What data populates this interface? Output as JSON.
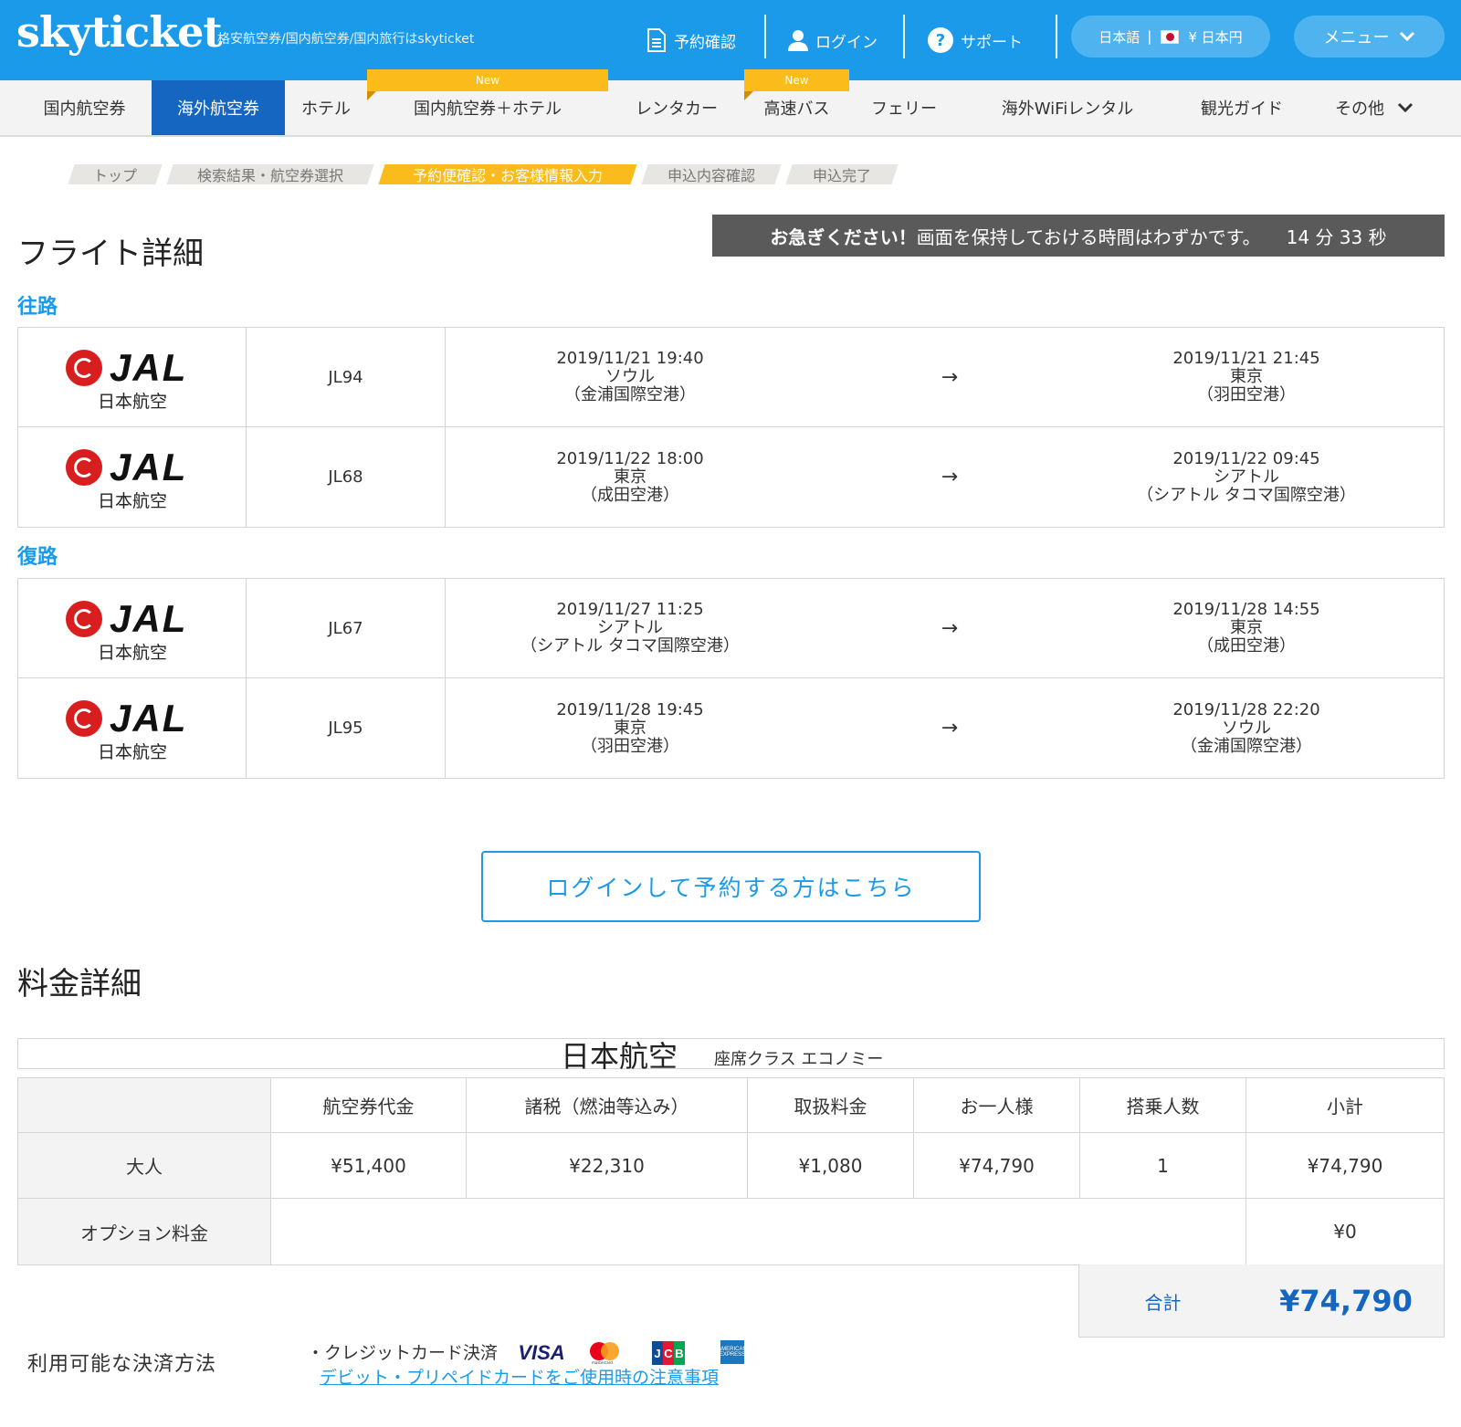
{
  "header": {
    "logo": "skyticket",
    "tagline": "格安航空券/国内航空券/国内旅行はskyticket",
    "nav": {
      "reservation": "予約確認",
      "login": "ログイン",
      "support": "サポート",
      "language": "日本語",
      "currency": "¥ 日本円",
      "menu": "メニュー"
    }
  },
  "categories": [
    {
      "label": "国内航空券"
    },
    {
      "label": "海外航空券"
    },
    {
      "label": "ホテル"
    },
    {
      "label": "国内航空券＋ホテル"
    },
    {
      "label": "レンタカー"
    },
    {
      "label": "高速バス"
    },
    {
      "label": "フェリー"
    },
    {
      "label": "海外WiFiレンタル"
    },
    {
      "label": "観光ガイド"
    },
    {
      "label": "その他"
    }
  ],
  "new_badge": "New",
  "steps": [
    {
      "label": "トップ"
    },
    {
      "label": "検索結果・航空券選択"
    },
    {
      "label": "予約便確認・お客様情報入力"
    },
    {
      "label": "申込内容確認"
    },
    {
      "label": "申込完了"
    }
  ],
  "flight_section": {
    "title": "フライト詳細",
    "timer_prefix": "お急ぎください！",
    "timer_text": "画面を保持しておける時間はわずかです。",
    "timer_value": "14 分 33 秒",
    "outbound_label": "往路",
    "return_label": "復路",
    "arrow": "→",
    "airline_logo_text": "JAL",
    "outbound": [
      {
        "airline": "日本航空",
        "flight_no": "JL94",
        "dep_time": "2019/11/21 19:40",
        "dep_city": "ソウル",
        "dep_airport": "（金浦国際空港）",
        "arr_time": "2019/11/21 21:45",
        "arr_city": "東京",
        "arr_airport": "（羽田空港）"
      },
      {
        "airline": "日本航空",
        "flight_no": "JL68",
        "dep_time": "2019/11/22 18:00",
        "dep_city": "東京",
        "dep_airport": "（成田空港）",
        "arr_time": "2019/11/22 09:45",
        "arr_city": "シアトル",
        "arr_airport": "（シアトル タコマ国際空港）"
      }
    ],
    "return": [
      {
        "airline": "日本航空",
        "flight_no": "JL67",
        "dep_time": "2019/11/27 11:25",
        "dep_city": "シアトル",
        "dep_airport": "（シアトル タコマ国際空港）",
        "arr_time": "2019/11/28 14:55",
        "arr_city": "東京",
        "arr_airport": "（成田空港）"
      },
      {
        "airline": "日本航空",
        "flight_no": "JL95",
        "dep_time": "2019/11/28 19:45",
        "dep_city": "東京",
        "dep_airport": "（羽田空港）",
        "arr_time": "2019/11/28 22:20",
        "arr_city": "ソウル",
        "arr_airport": "（金浦国際空港）"
      }
    ]
  },
  "login_button": "ログインして予約する方はこちら",
  "fare": {
    "title": "料金詳細",
    "airline": "日本航空",
    "seat_class": "座席クラス エコノミー",
    "headers": [
      "航空券代金",
      "諸税（燃油等込み）",
      "取扱料金",
      "お一人様",
      "搭乗人数",
      "小計"
    ],
    "adult": {
      "label": "大人",
      "values": [
        "¥51,400",
        "¥22,310",
        "¥1,080",
        "¥74,790",
        "1",
        "¥74,790"
      ]
    },
    "option": {
      "label": "オプション料金",
      "value": "¥0"
    },
    "total_label": "合計",
    "total_value": "¥74,790"
  },
  "payment": {
    "label": "利用可能な決済方法",
    "credit": "・クレジットカード決済",
    "link": "デビット・プリペイドカードをご使用時の注意事項",
    "cards": {
      "visa": "VISA",
      "jcb": "JCB",
      "mastercard_text": "mastercard",
      "amex_text": "AMERICAN EXPRESS"
    }
  },
  "colors": {
    "brand": "#1a9ae8",
    "accent_orange": "#fbbb1a",
    "active_tab": "#1566c0",
    "jal_red": "#d81e1e"
  }
}
